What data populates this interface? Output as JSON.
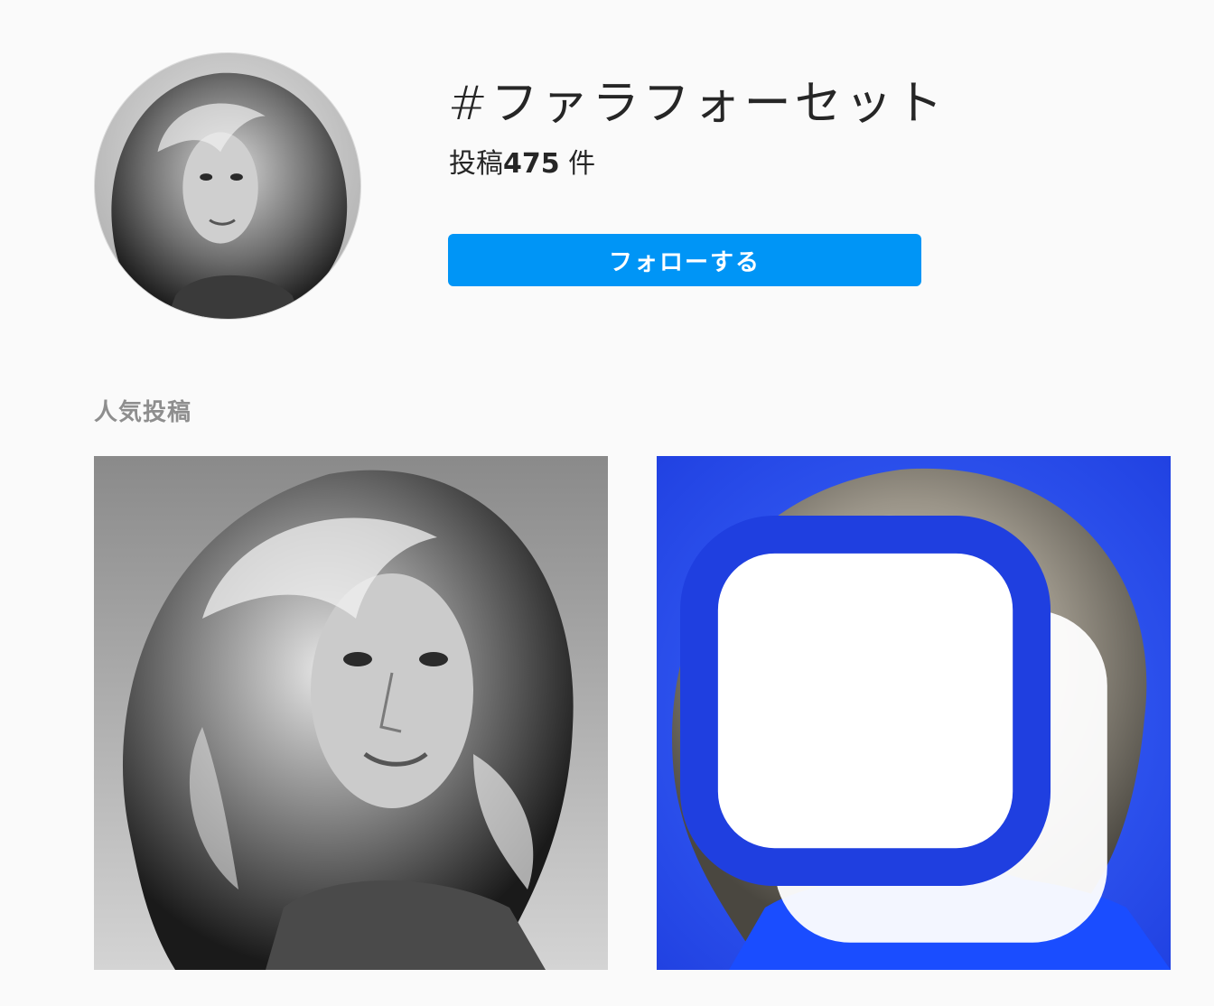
{
  "header": {
    "hashtag_title": "#ファラフォーセット",
    "post_count_prefix": "投稿",
    "post_count_number": "475",
    "post_count_suffix": " 件",
    "follow_label": "フォローする",
    "avatar_icon": "hashtag-avatar-photo"
  },
  "top_posts": {
    "section_label": "人気投稿",
    "posts": [
      {
        "style": "black-and-white portrait",
        "multi_image": false
      },
      {
        "style": "color portrait on blue background",
        "multi_image": true,
        "badge_icon": "carousel-icon"
      }
    ]
  },
  "colors": {
    "background": "#fafafa",
    "accent": "#0095f6",
    "text_primary": "#262626",
    "text_secondary": "#8e8e8e"
  }
}
